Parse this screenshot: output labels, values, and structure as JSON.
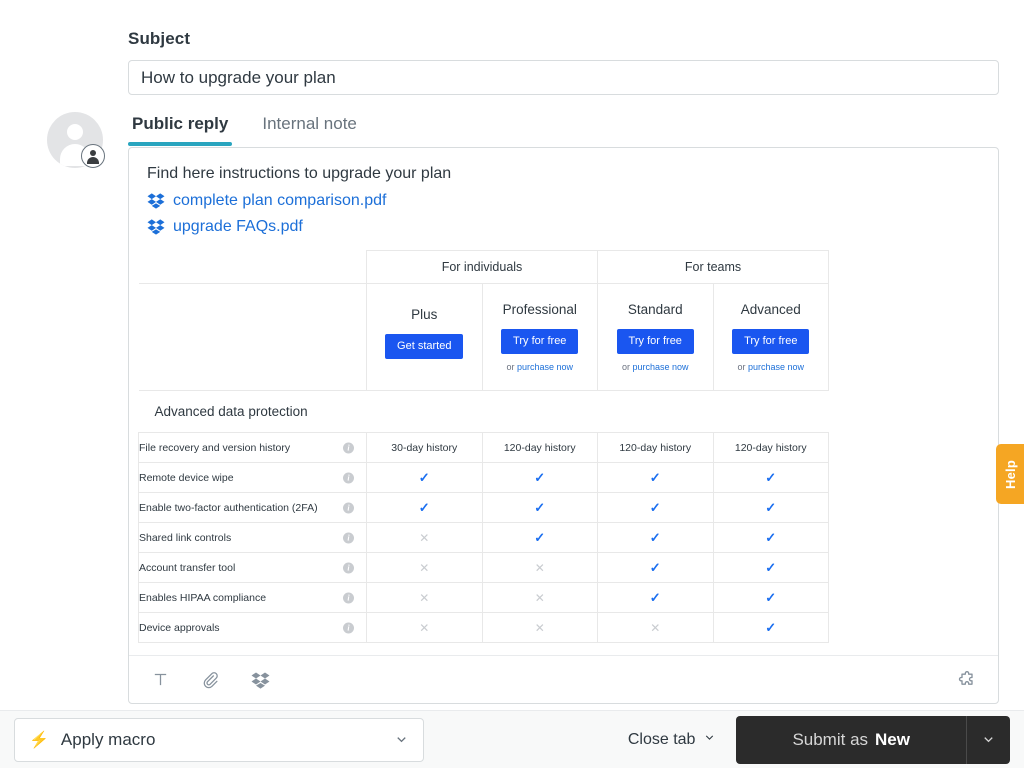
{
  "subject": {
    "label": "Subject",
    "value": "How to upgrade your plan"
  },
  "tabs": [
    {
      "label": "Public reply",
      "active": true
    },
    {
      "label": "Internal note",
      "active": false
    }
  ],
  "composer": {
    "intro": "Find here instructions to upgrade your plan",
    "attachments": [
      {
        "name": "complete plan comparison.pdf",
        "icon": "dropbox-icon"
      },
      {
        "name": "upgrade FAQs.pdf",
        "icon": "dropbox-icon"
      }
    ],
    "toolbar": {
      "text_format": "T",
      "attach": "paperclip-icon",
      "dropbox": "dropbox-icon",
      "apps": "puzzle-piece-icon"
    }
  },
  "plan_table": {
    "groups": [
      {
        "label": "For individuals",
        "span": 2
      },
      {
        "label": "For teams",
        "span": 2
      }
    ],
    "plans": [
      {
        "name": "Plus",
        "cta": "Get started",
        "sub_prefix": "",
        "sub_link": ""
      },
      {
        "name": "Professional",
        "cta": "Try for free",
        "sub_prefix": "or ",
        "sub_link": "purchase now"
      },
      {
        "name": "Standard",
        "cta": "Try for free",
        "sub_prefix": "or ",
        "sub_link": "purchase now"
      },
      {
        "name": "Advanced",
        "cta": "Try for free",
        "sub_prefix": "or ",
        "sub_link": "purchase now"
      }
    ],
    "section_title": "Advanced data protection",
    "rows": [
      {
        "feature": "File recovery and version history",
        "values": [
          "30-day history",
          "120-day history",
          "120-day history",
          "120-day history"
        ]
      },
      {
        "feature": "Remote device wipe",
        "values": [
          "check",
          "check",
          "check",
          "check"
        ]
      },
      {
        "feature": "Enable two-factor authentication (2FA)",
        "values": [
          "check",
          "check",
          "check",
          "check"
        ]
      },
      {
        "feature": "Shared link controls",
        "values": [
          "cross",
          "check",
          "check",
          "check"
        ]
      },
      {
        "feature": "Account transfer tool",
        "values": [
          "cross",
          "cross",
          "check",
          "check"
        ]
      },
      {
        "feature": "Enables HIPAA compliance",
        "values": [
          "cross",
          "cross",
          "check",
          "check"
        ]
      },
      {
        "feature": "Device approvals",
        "values": [
          "cross",
          "cross",
          "cross",
          "check"
        ]
      }
    ]
  },
  "help_tab": {
    "label": "Help"
  },
  "bottom_bar": {
    "macro": {
      "label": "Apply macro",
      "icon": "lightning-bolt-icon"
    },
    "close_tab": "Close tab",
    "submit": {
      "prefix": "Submit as",
      "status": "New"
    }
  },
  "colors": {
    "accent_teal": "#29a5bf",
    "link_blue": "#1c6fd8",
    "button_blue": "#1a56f0",
    "help_orange": "#f5a623",
    "submit_dark": "#2b2b2b"
  }
}
